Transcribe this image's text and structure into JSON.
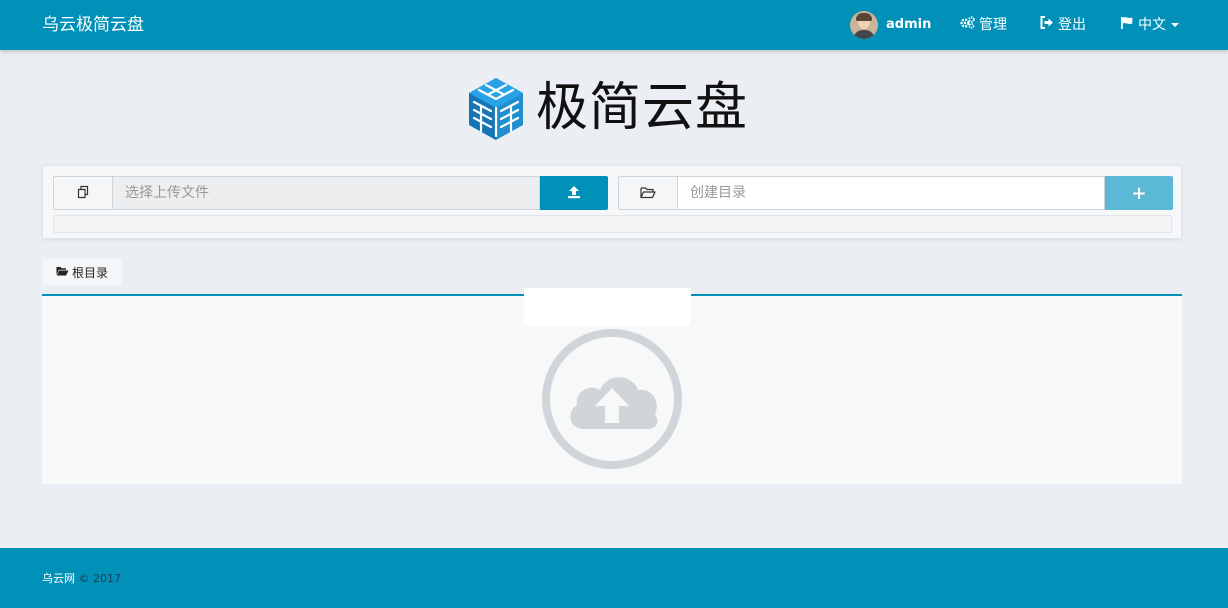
{
  "navbar": {
    "brand": "乌云极简云盘",
    "user": "admin",
    "manage_label": "管理",
    "logout_label": "登出",
    "language_label": "中文"
  },
  "logo": {
    "text": "极简云盘"
  },
  "upload": {
    "file_placeholder": "选择上传文件",
    "mkdir_placeholder": "创建目录",
    "add_label": "+"
  },
  "breadcrumb": {
    "root_label": "根目录"
  },
  "footer": {
    "site": "乌云网",
    "copyright": "© 2017"
  },
  "colors": {
    "primary": "#0190b8",
    "secondary": "#5bb8d6",
    "background": "#ebeff3"
  }
}
